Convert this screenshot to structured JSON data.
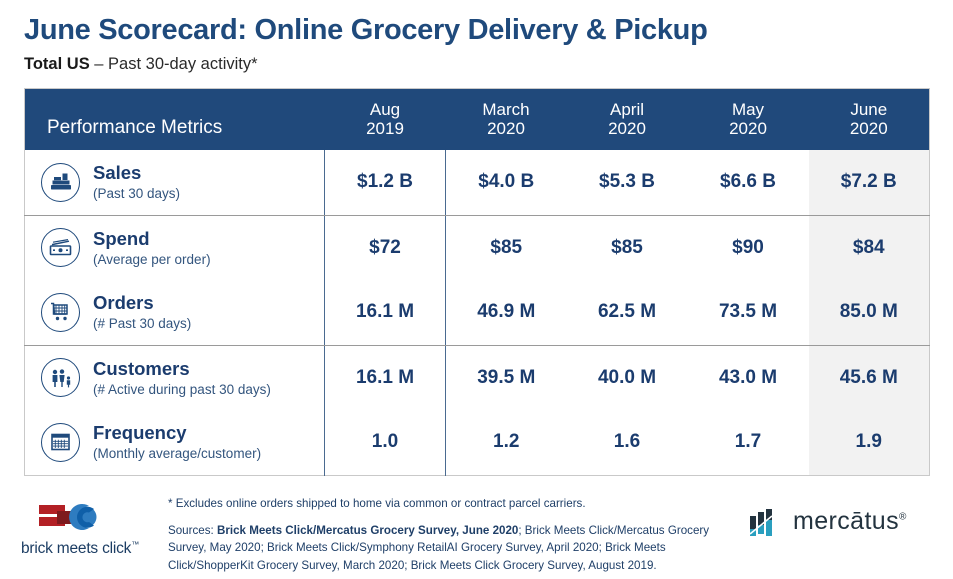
{
  "header": {
    "title": "June Scorecard: Online Grocery Delivery & Pickup",
    "subtitle_strong": "Total US",
    "subtitle_rest": " – Past 30-day activity*"
  },
  "table": {
    "metrics_header": "Performance Metrics",
    "columns": [
      {
        "month": "Aug",
        "year": "2019",
        "highlight": false
      },
      {
        "month": "March",
        "year": "2020",
        "highlight": false
      },
      {
        "month": "April",
        "year": "2020",
        "highlight": false
      },
      {
        "month": "May",
        "year": "2020",
        "highlight": false
      },
      {
        "month": "June",
        "year": "2020",
        "highlight": true
      }
    ],
    "rows": [
      {
        "icon": "cash-register-icon",
        "name": "Sales",
        "sub": "(Past 30 days)",
        "values": [
          "$1.2 B",
          "$4.0 B",
          "$5.3 B",
          "$6.6 B",
          "$7.2 B"
        ],
        "group_end": true
      },
      {
        "icon": "money-bill-icon",
        "name": "Spend",
        "sub": "(Average per order)",
        "values": [
          "$72",
          "$85",
          "$85",
          "$90",
          "$84"
        ],
        "group_end": false
      },
      {
        "icon": "shopping-cart-icon",
        "name": "Orders",
        "sub": "(# Past 30 days)",
        "values": [
          "16.1 M",
          "46.9 M",
          "62.5 M",
          "73.5 M",
          "85.0 M"
        ],
        "group_end": true
      },
      {
        "icon": "family-people-icon",
        "name": "Customers",
        "sub": "(# Active during past 30 days)",
        "values": [
          "16.1 M",
          "39.5 M",
          "40.0 M",
          "43.0 M",
          "45.6 M"
        ],
        "group_end": false
      },
      {
        "icon": "calendar-icon",
        "name": "Frequency",
        "sub": "(Monthly average/customer)",
        "values": [
          "1.0",
          "1.2",
          "1.6",
          "1.7",
          "1.9"
        ],
        "group_end": false
      }
    ]
  },
  "footer": {
    "exclusion_note": "* Excludes online orders shipped to home via common or contract parcel carriers.",
    "sources_label": "Sources: ",
    "sources_bold": "Brick Meets Click/Mercatus Grocery Survey, June 2020",
    "sources_rest": ";  Brick Meets Click/Mercatus Grocery Survey, May 2020; Brick Meets Click/Symphony RetailAI Grocery Survey, April 2020; Brick Meets Click/ShopperKit Grocery Survey, March 2020; Brick Meets Click Grocery Survey, August 2019.",
    "logo_left_text": "brick meets click",
    "logo_left_tm": "™",
    "logo_right_text": "mercātus",
    "logo_right_reg": "®"
  },
  "colors": {
    "header_blue": "#20497B",
    "title_blue": "#1F4A7C",
    "value_navy": "#1B3C6E",
    "highlight_gray": "#F2F2F2",
    "brick_red": "#B32025",
    "brick_blue": "#2E7CC0",
    "mercatus_dark": "#23333F",
    "mercatus_teal": "#2A9FBF"
  }
}
